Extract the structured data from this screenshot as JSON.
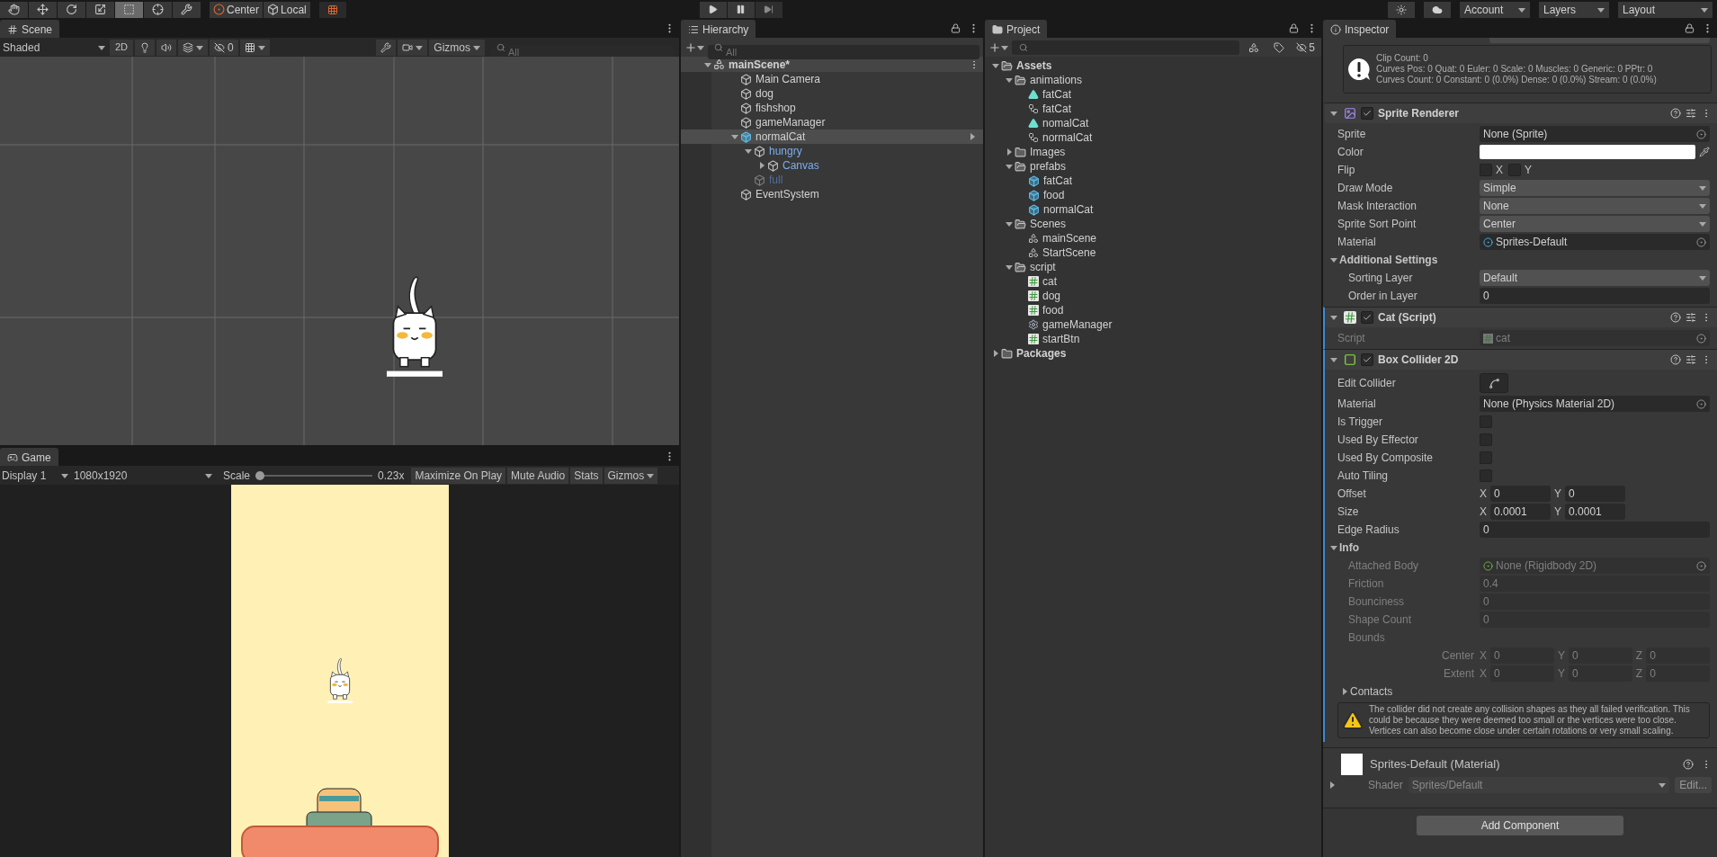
{
  "toolbar": {
    "tools": [
      {
        "kind": "hand",
        "selected": false
      },
      {
        "kind": "move",
        "selected": false
      },
      {
        "kind": "rotate",
        "selected": false
      },
      {
        "kind": "scale",
        "selected": false
      },
      {
        "kind": "rect",
        "selected": true
      },
      {
        "kind": "transform",
        "selected": false
      },
      {
        "kind": "custom",
        "selected": false
      }
    ],
    "pivot": "Center",
    "space": "Local",
    "account": "Account",
    "layers": "Layers",
    "layout": "Layout"
  },
  "scene": {
    "tab": "Scene",
    "shading": "Shaded",
    "mode_2d": "2D",
    "hidden_count": "0",
    "gizmos": "Gizmos",
    "search_placeholder": "All"
  },
  "game": {
    "tab": "Game",
    "display": "Display 1",
    "resolution": "1080x1920",
    "scale_label": "Scale",
    "scale": {
      "level": 0.0,
      "reading": "0.23x"
    },
    "buttons": [
      "Maximize On Play",
      "Mute Audio",
      "Stats"
    ],
    "gizmos": "Gizmos"
  },
  "hierarchy": {
    "tab": "Hierarchy",
    "search_placeholder": "All",
    "scene": {
      "label": "mainScene*",
      "expanded": true,
      "children": [
        {
          "label": "Main Camera",
          "kind": "object",
          "selected": false,
          "active": true
        },
        {
          "label": "dog",
          "kind": "object",
          "selected": false,
          "active": true
        },
        {
          "label": "fishshop",
          "kind": "object",
          "selected": false,
          "active": true
        },
        {
          "label": "gameManager",
          "kind": "object",
          "selected": false,
          "active": true
        },
        {
          "label": "normalCat",
          "kind": "prefab_root",
          "selected": true,
          "active": true,
          "expanded": true,
          "children": [
            {
              "label": "hungry",
              "kind": "prefab_part",
              "selected": false,
              "active": true,
              "expanded": true,
              "children": [
                {
                  "label": "Canvas",
                  "kind": "prefab_part",
                  "selected": false,
                  "active": true,
                  "expanded": false
                }
              ]
            },
            {
              "label": "full",
              "kind": "prefab_part",
              "selected": false,
              "active": false
            }
          ]
        },
        {
          "label": "EventSystem",
          "kind": "object",
          "selected": false,
          "active": true
        }
      ]
    }
  },
  "project": {
    "tab": "Project",
    "hidden_count": "5",
    "tree": [
      {
        "label": "Assets",
        "kind": "folder",
        "expanded": true,
        "children": [
          {
            "label": "animations",
            "kind": "folder",
            "expanded": true,
            "children": [
              {
                "label": "fatCat",
                "kind": "animation"
              },
              {
                "label": "fatCat",
                "kind": "controller"
              },
              {
                "label": "nomalCat",
                "kind": "animation"
              },
              {
                "label": "normalCat",
                "kind": "controller"
              }
            ]
          },
          {
            "label": "Images",
            "kind": "folder",
            "expanded": false
          },
          {
            "label": "prefabs",
            "kind": "folder",
            "expanded": true,
            "children": [
              {
                "label": "fatCat",
                "kind": "prefab"
              },
              {
                "label": "food",
                "kind": "prefab"
              },
              {
                "label": "normalCat",
                "kind": "prefab"
              }
            ]
          },
          {
            "label": "Scenes",
            "kind": "folder",
            "expanded": true,
            "children": [
              {
                "label": "mainScene",
                "kind": "scene"
              },
              {
                "label": "StartScene",
                "kind": "scene"
              }
            ]
          },
          {
            "label": "script",
            "kind": "folder",
            "expanded": true,
            "children": [
              {
                "label": "cat",
                "kind": "script"
              },
              {
                "label": "dog",
                "kind": "script"
              },
              {
                "label": "food",
                "kind": "script"
              },
              {
                "label": "gameManager",
                "kind": "manager_script"
              },
              {
                "label": "startBtn",
                "kind": "script"
              }
            ]
          }
        ]
      },
      {
        "label": "Packages",
        "kind": "folder",
        "expanded": false
      }
    ]
  },
  "inspector": {
    "tab": "Inspector",
    "info_box": [
      "Clip Count: 0",
      "Curves Pos: 0 Quat: 0 Euler: 0 Scale: 0 Muscles: 0 Generic: 0 PPtr: 0",
      "Curves Count: 0 Constant: 0 (0.0%) Dense: 0 (0.0%) Stream: 0 (0.0%)"
    ],
    "components": [
      {
        "kind": "sprite_renderer",
        "title": "Sprite Renderer",
        "enabled": true,
        "expanded": true,
        "overridden": false,
        "fields": [
          {
            "kind": "object",
            "label": "Sprite",
            "value": "None (Sprite)"
          },
          {
            "kind": "color",
            "label": "Color",
            "color": "#ffffff"
          },
          {
            "kind": "toggles",
            "label": "Flip",
            "toggles": [
              {
                "label": "X",
                "checked": false
              },
              {
                "label": "Y",
                "checked": false
              }
            ]
          },
          {
            "kind": "dropdown",
            "label": "Draw Mode",
            "value": "Simple"
          },
          {
            "kind": "dropdown",
            "label": "Mask Interaction",
            "value": "None"
          },
          {
            "kind": "dropdown",
            "label": "Sprite Sort Point",
            "value": "Center"
          },
          {
            "kind": "material_object",
            "label": "Material",
            "value": "Sprites-Default"
          },
          {
            "kind": "section",
            "label": "Additional Settings",
            "expanded": true,
            "children": [
              {
                "kind": "dropdown",
                "label": "Sorting Layer",
                "value": "Default"
              },
              {
                "kind": "text",
                "label": "Order in Layer",
                "value": "0"
              }
            ]
          }
        ]
      },
      {
        "kind": "script",
        "title": "Cat (Script)",
        "enabled": true,
        "expanded": true,
        "overridden": true,
        "fields": [
          {
            "kind": "script_object",
            "label": "Script",
            "value": "cat",
            "disabled": true
          }
        ]
      },
      {
        "kind": "box_collider",
        "title": "Box Collider 2D",
        "enabled": true,
        "expanded": true,
        "overridden": true,
        "fields": [
          {
            "kind": "edit_button",
            "label": "Edit Collider"
          },
          {
            "kind": "object",
            "label": "Material",
            "value": "None (Physics Material 2D)"
          },
          {
            "kind": "checkbox",
            "label": "Is Trigger",
            "checked": false
          },
          {
            "kind": "checkbox",
            "label": "Used By Effector",
            "checked": false
          },
          {
            "kind": "checkbox",
            "label": "Used By Composite",
            "checked": false
          },
          {
            "kind": "checkbox",
            "label": "Auto Tiling",
            "checked": false
          },
          {
            "kind": "vector",
            "label": "Offset",
            "axes": [
              {
                "axis": "X",
                "value": "0"
              },
              {
                "axis": "Y",
                "value": "0"
              }
            ]
          },
          {
            "kind": "vector",
            "label": "Size",
            "axes": [
              {
                "axis": "X",
                "value": "0.0001"
              },
              {
                "axis": "Y",
                "value": "0.0001"
              }
            ]
          },
          {
            "kind": "text",
            "label": "Edge Radius",
            "value": "0"
          },
          {
            "kind": "section",
            "label": "Info",
            "expanded": true,
            "children": [
              {
                "kind": "body_object",
                "label": "Attached Body",
                "value": "None (Rigidbody 2D)",
                "disabled": true
              },
              {
                "kind": "text",
                "label": "Friction",
                "value": "0.4",
                "disabled": true
              },
              {
                "kind": "text",
                "label": "Bounciness",
                "value": "0",
                "disabled": true
              },
              {
                "kind": "text",
                "label": "Shape Count",
                "value": "0",
                "disabled": true
              },
              {
                "kind": "group",
                "label": "Bounds",
                "disabled": true,
                "children": [
                  {
                    "kind": "vector",
                    "label": "Center",
                    "disabled": true,
                    "axes": [
                      {
                        "axis": "X",
                        "value": "0"
                      },
                      {
                        "axis": "Y",
                        "value": "0"
                      },
                      {
                        "axis": "Z",
                        "value": "0"
                      }
                    ]
                  },
                  {
                    "kind": "vector",
                    "label": "Extent",
                    "disabled": true,
                    "axes": [
                      {
                        "axis": "X",
                        "value": "0"
                      },
                      {
                        "axis": "Y",
                        "value": "0"
                      },
                      {
                        "axis": "Z",
                        "value": "0"
                      }
                    ]
                  }
                ]
              },
              {
                "kind": "section",
                "label": "Contacts",
                "expanded": false
              }
            ]
          },
          {
            "kind": "warning",
            "text": "The collider did not create any collision shapes as they all failed verification. This could be because they were deemed too small or the vertices were too close.  Vertices can also become close under certain rotations or very small scaling."
          }
        ]
      }
    ],
    "material": {
      "name": "Sprites-Default (Material)",
      "shader_label": "Shader",
      "shader": "Sprites/Default",
      "edit": "Edit..."
    },
    "add_component": "Add Component"
  }
}
